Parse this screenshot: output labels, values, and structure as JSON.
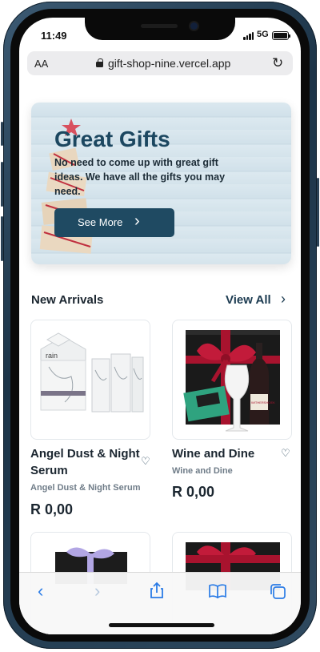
{
  "status": {
    "time": "11:49",
    "network": "5G"
  },
  "browser": {
    "aa_label": "AA",
    "url": "gift-shop-nine.vercel.app",
    "reload_icon": "reload-icon",
    "lock_icon": "lock-icon"
  },
  "hero": {
    "title": "Great Gifts",
    "text": "No need to come up with great gift ideas. We have all the gifts you may need.",
    "button_label": "See More",
    "button_icon": "chevron-right-icon"
  },
  "new_arrivals": {
    "title": "New Arrivals",
    "view_all": "View All",
    "products": [
      {
        "name": "Angel Dust & Night Serum",
        "subtitle": "Angel Dust & Night Serum",
        "price": "R 0,00",
        "brand_text": "rain"
      },
      {
        "name": "Wine and Dine",
        "subtitle": "Wine and Dine",
        "price": "R 0,00",
        "brand_text": "WITHERSHOEK"
      }
    ]
  },
  "toolbar": {
    "icons": [
      "back-icon",
      "forward-icon",
      "share-icon",
      "bookmarks-icon",
      "tabs-icon"
    ]
  },
  "colors": {
    "primary": "#1f4a62",
    "text": "#1b2630",
    "muted": "#6f7c88",
    "ios_blue": "#2a7be6"
  }
}
